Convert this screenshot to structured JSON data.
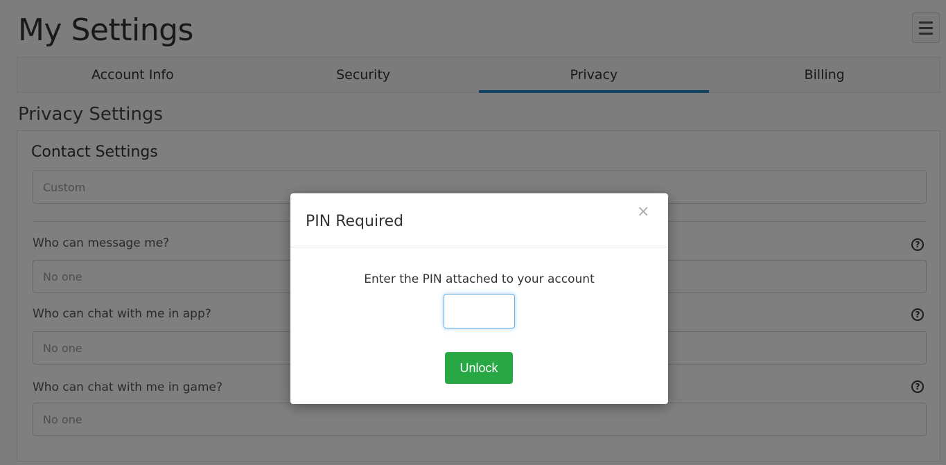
{
  "header": {
    "title": "My Settings"
  },
  "tabs": [
    {
      "label": "Account Info",
      "active": false
    },
    {
      "label": "Security",
      "active": false
    },
    {
      "label": "Privacy",
      "active": true
    },
    {
      "label": "Billing",
      "active": false
    }
  ],
  "privacy": {
    "section_title": "Privacy Settings",
    "card_title": "Contact Settings",
    "preset_value": "Custom",
    "questions": [
      {
        "label": "Who can message me?",
        "value": "No one"
      },
      {
        "label": "Who can chat with me in app?",
        "value": "No one"
      },
      {
        "label": "Who can chat with me in game?",
        "value": "No one"
      }
    ]
  },
  "modal": {
    "title": "PIN Required",
    "close_symbol": "×",
    "description": "Enter the PIN attached to your account",
    "pin_value": "",
    "unlock_label": "Unlock"
  },
  "icons": {
    "help": "?"
  },
  "colors": {
    "accent": "#2185c5",
    "unlock": "#28a745",
    "input_focus": "#66afe9"
  }
}
